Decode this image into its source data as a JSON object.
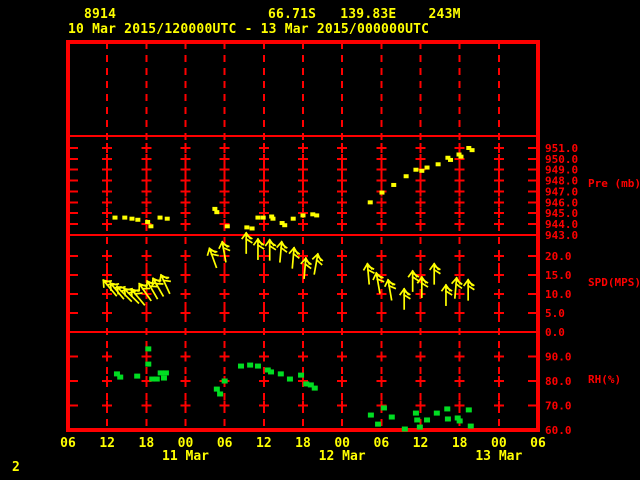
{
  "header": {
    "station_id": "8914",
    "location": "66.71S   139.83E    243M",
    "period": "10 Mar 2015/120000UTC - 13 Mar 2015/000000UTC"
  },
  "footer": {
    "page_number": "2"
  },
  "colors": {
    "background": "#000000",
    "grid_red": "#ff0000",
    "text_yellow": "#ffff00",
    "series_yellow": "#ffff00",
    "series_green": "#00dd22"
  },
  "chart_data": {
    "type": "scatter",
    "title": "Station time-series: pressure, wind speed, relative humidity",
    "x_axis": {
      "tick_hours": [
        0,
        6,
        12,
        18,
        24,
        30,
        36,
        42,
        48,
        54,
        60,
        66,
        72
      ],
      "tick_labels": [
        "06",
        "12",
        "18",
        "00",
        "06",
        "12",
        "18",
        "00",
        "06",
        "12",
        "18",
        "00",
        "06"
      ],
      "day_labels": [
        {
          "label": "11 Mar",
          "hour": 18
        },
        {
          "label": "12 Mar",
          "hour": 42
        },
        {
          "label": "13 Mar",
          "hour": 66
        }
      ]
    },
    "panels": [
      {
        "id": "top-blank",
        "ylabel": "",
        "ylim": [
          0,
          1
        ],
        "yticks": []
      },
      {
        "id": "pressure",
        "ylabel": "Pre (mb)",
        "ylim": [
          943,
          952.1
        ],
        "yticks": [
          943,
          944,
          945,
          946,
          947,
          948,
          949,
          950,
          951
        ],
        "points": [
          [
            7.2,
            944.6
          ],
          [
            8.7,
            944.6
          ],
          [
            9.8,
            944.5
          ],
          [
            10.7,
            944.4
          ],
          [
            12.2,
            944.2
          ],
          [
            12.7,
            943.8
          ],
          [
            14.1,
            944.6
          ],
          [
            15.2,
            944.5
          ],
          [
            22.5,
            945.4
          ],
          [
            22.8,
            945.1
          ],
          [
            24.4,
            943.8
          ],
          [
            27.4,
            943.7
          ],
          [
            28.2,
            943.6
          ],
          [
            29.1,
            944.6
          ],
          [
            29.9,
            944.6
          ],
          [
            31.2,
            944.7
          ],
          [
            31.4,
            944.5
          ],
          [
            32.8,
            944.1
          ],
          [
            33.2,
            943.9
          ],
          [
            34.5,
            944.5
          ],
          [
            36.0,
            944.8
          ],
          [
            37.5,
            944.9
          ],
          [
            38.1,
            944.8
          ],
          [
            46.3,
            946.0
          ],
          [
            48.1,
            946.9
          ],
          [
            49.9,
            947.6
          ],
          [
            51.8,
            948.4
          ],
          [
            53.3,
            949.0
          ],
          [
            54.2,
            948.9
          ],
          [
            55.0,
            949.2
          ],
          [
            56.7,
            949.5
          ],
          [
            58.2,
            950.1
          ],
          [
            58.6,
            949.9
          ],
          [
            59.9,
            950.4
          ],
          [
            60.2,
            950.2
          ],
          [
            61.4,
            951.0
          ],
          [
            61.9,
            950.8
          ]
        ]
      },
      {
        "id": "wind-speed",
        "ylabel": "SPD(MPS)",
        "ylim": [
          0,
          25.5
        ],
        "yticks": [
          0,
          5,
          10,
          15,
          20
        ],
        "barbs": [
          [
            6.4,
            11.6,
            -40
          ],
          [
            7.5,
            10.8,
            -40
          ],
          [
            8.6,
            10.0,
            -45
          ],
          [
            9.7,
            9.5,
            -45
          ],
          [
            10.7,
            9.2,
            -40
          ],
          [
            11.8,
            10.5,
            -35
          ],
          [
            12.9,
            11.1,
            -30
          ],
          [
            13.8,
            11.8,
            -30
          ],
          [
            14.9,
            12.6,
            -25
          ],
          [
            22.2,
            19.5,
            -20
          ],
          [
            23.9,
            21.1,
            -10
          ],
          [
            27.3,
            23.4,
            0
          ],
          [
            29.1,
            21.8,
            0
          ],
          [
            30.9,
            21.6,
            0
          ],
          [
            32.6,
            21.1,
            5
          ],
          [
            34.5,
            19.5,
            5
          ],
          [
            36.3,
            16.8,
            5
          ],
          [
            38.0,
            17.9,
            10
          ],
          [
            46.0,
            15.3,
            -5
          ],
          [
            47.5,
            12.9,
            -10
          ],
          [
            49.3,
            11.1,
            -10
          ],
          [
            51.5,
            8.7,
            0
          ],
          [
            52.8,
            13.4,
            0
          ],
          [
            54.2,
            11.8,
            0
          ],
          [
            56.1,
            15.3,
            0
          ],
          [
            57.9,
            9.7,
            0
          ],
          [
            59.4,
            11.6,
            5
          ],
          [
            61.3,
            11.1,
            0
          ]
        ]
      },
      {
        "id": "humidity",
        "ylabel": "RH(%)",
        "ylim": [
          60,
          100
        ],
        "yticks": [
          60,
          70,
          80,
          90
        ],
        "points": [
          [
            7.5,
            82.9
          ],
          [
            8.0,
            81.6
          ],
          [
            10.6,
            82.0
          ],
          [
            12.3,
            93.1
          ],
          [
            12.3,
            86.9
          ],
          [
            12.9,
            80.8
          ],
          [
            13.6,
            80.8
          ],
          [
            14.2,
            83.3
          ],
          [
            14.7,
            81.2
          ],
          [
            15.0,
            83.3
          ],
          [
            22.8,
            76.7
          ],
          [
            23.3,
            74.7
          ],
          [
            24.0,
            80.0
          ],
          [
            26.5,
            86.1
          ],
          [
            27.9,
            86.5
          ],
          [
            29.1,
            86.1
          ],
          [
            30.6,
            84.5
          ],
          [
            31.1,
            83.7
          ],
          [
            32.6,
            82.9
          ],
          [
            34.0,
            80.8
          ],
          [
            35.7,
            82.4
          ],
          [
            36.5,
            78.8
          ],
          [
            37.2,
            78.4
          ],
          [
            37.8,
            77.1
          ],
          [
            46.4,
            66.1
          ],
          [
            47.5,
            62.4
          ],
          [
            48.4,
            69.0
          ],
          [
            49.6,
            65.3
          ],
          [
            51.6,
            60.4
          ],
          [
            53.3,
            66.9
          ],
          [
            53.5,
            64.1
          ],
          [
            53.9,
            61.2
          ],
          [
            55.0,
            64.1
          ],
          [
            56.5,
            66.9
          ],
          [
            58.1,
            68.6
          ],
          [
            58.2,
            64.5
          ],
          [
            59.7,
            64.9
          ],
          [
            60.0,
            63.7
          ],
          [
            61.4,
            68.2
          ],
          [
            61.7,
            61.6
          ]
        ]
      }
    ]
  }
}
